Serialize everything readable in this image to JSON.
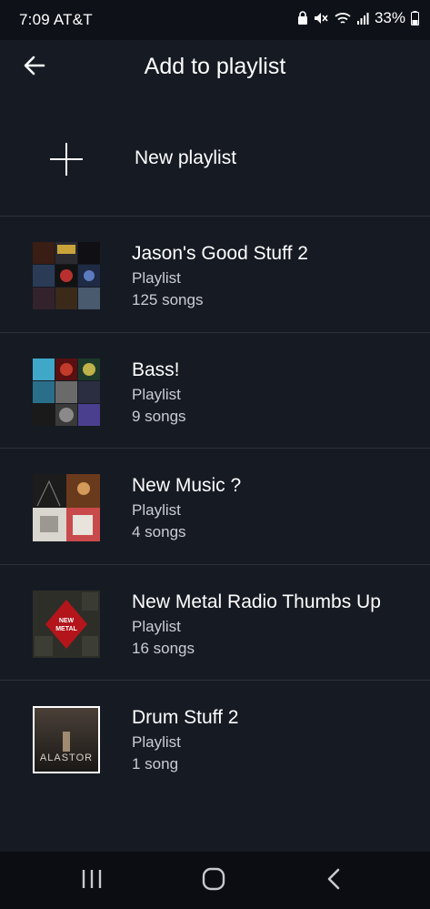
{
  "status": {
    "time": "7:09",
    "carrier": "AT&T",
    "battery": "33%",
    "icons": [
      "lock-icon",
      "mute-icon",
      "wifi-icon",
      "signal-icon",
      "battery-icon"
    ]
  },
  "header": {
    "title": "Add to playlist",
    "back_icon": "arrow-left-icon"
  },
  "new_playlist": {
    "label": "New playlist",
    "icon": "plus-icon"
  },
  "playlists": [
    {
      "name": "Jason's Good Stuff 2",
      "type": "Playlist",
      "count": "125 songs"
    },
    {
      "name": "Bass!",
      "type": "Playlist",
      "count": "9 songs"
    },
    {
      "name": "New Music ?",
      "type": "Playlist",
      "count": "4 songs"
    },
    {
      "name": "New Metal Radio Thumbs Up",
      "type": "Playlist",
      "count": "16 songs",
      "thumb_text": "NEW METAL"
    },
    {
      "name": "Drum Stuff 2",
      "type": "Playlist",
      "count": "1 song",
      "thumb_text": "ALASTOR"
    }
  ],
  "nav": {
    "icons": [
      "recent-apps-icon",
      "home-icon",
      "back-icon"
    ]
  },
  "colors": {
    "background": "#161a23",
    "statusbar": "#0e1117",
    "navbar": "#0b0d12",
    "divider": "#2c313b",
    "secondary_text": "#c9ccd3"
  }
}
